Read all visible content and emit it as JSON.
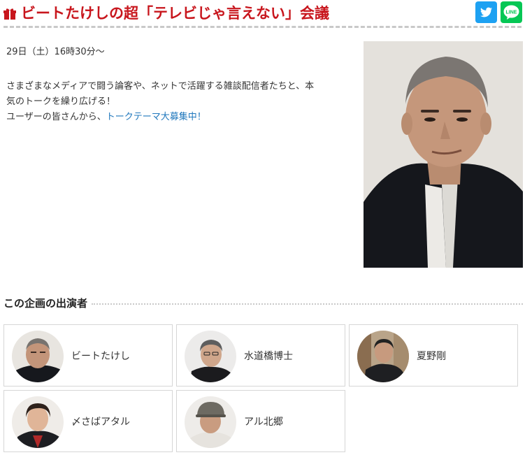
{
  "header": {
    "title": "ビートたけしの超「テレビじゃ言えない」会議",
    "accent_color": "#c8161d",
    "icon": "gift-icon",
    "share": [
      {
        "name": "twitter",
        "icon": "twitter-icon",
        "color": "#1da1f2"
      },
      {
        "name": "line",
        "icon": "line-icon",
        "label": "LINE",
        "color": "#06c755"
      }
    ]
  },
  "event": {
    "datetime": "29日（土）16時30分～",
    "desc_line1": "さまざまなメディアで闘う論客や、ネットで活躍する雑談配信者たちと、本",
    "desc_line2": "気のトークを繰り広げる！",
    "desc_line3_prefix": "ユーザーの皆さんから、",
    "desc_link": "トークテーマ大募集中！",
    "link_color": "#2178bd"
  },
  "cast": {
    "heading": "この企画の出演者",
    "members": [
      {
        "name": "ビートたけし"
      },
      {
        "name": "水道橋博士"
      },
      {
        "name": "夏野剛"
      },
      {
        "name": "〆さばアタル"
      },
      {
        "name": "アル北郷"
      }
    ]
  }
}
